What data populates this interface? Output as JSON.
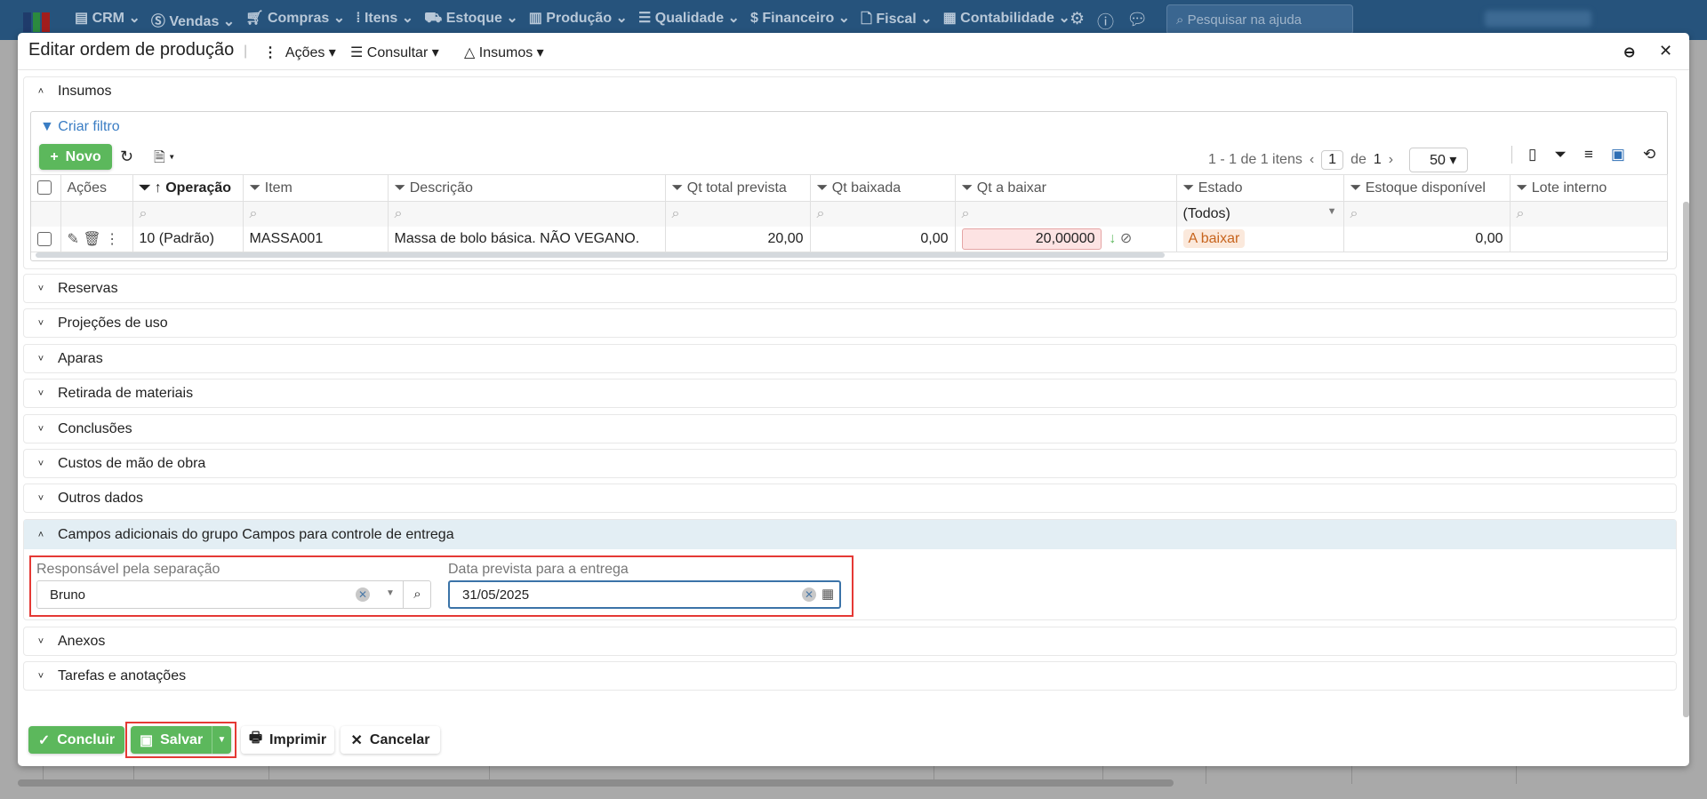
{
  "topnav": {
    "menus": [
      "CRM",
      "Vendas",
      "Compras",
      "Itens",
      "Estoque",
      "Produção",
      "Qualidade",
      "Financeiro",
      "Fiscal",
      "Contabilidade"
    ],
    "help_placeholder": "Pesquisar na ajuda"
  },
  "modal": {
    "title": "Editar ordem de produção",
    "toolbar": {
      "acoes": "Ações",
      "consultar": "Consultar",
      "insumos": "Insumos"
    }
  },
  "insumos": {
    "title": "Insumos",
    "criar_filtro": "Criar filtro",
    "novo": "Novo",
    "pagination": {
      "summary": "1 - 1 de 1 itens",
      "page": "1",
      "of": "de",
      "total": "1",
      "page_size": "50"
    },
    "columns": [
      "Ações",
      "Operação",
      "Item",
      "Descrição",
      "Qt total prevista",
      "Qt baixada",
      "Qt a baixar",
      "Estado",
      "Estoque disponível",
      "Lote interno"
    ],
    "estado_filter": "(Todos)",
    "rows": [
      {
        "operacao": "10 (Padrão)",
        "item": "MASSA001",
        "descricao": "Massa de bolo básica. NÃO VEGANO.",
        "qt_total_prevista": "20,00",
        "qt_baixada": "0,00",
        "qt_a_baixar": "20,00000",
        "estado": "A baixar",
        "estoque_disponivel": "0,00",
        "lote_interno": ""
      }
    ]
  },
  "sections": [
    "Reservas",
    "Projeções de uso",
    "Aparas",
    "Retirada de materiais",
    "Conclusões",
    "Custos de mão de obra",
    "Outros dados"
  ],
  "campos": {
    "title": "Campos adicionais do grupo Campos para controle de entrega",
    "responsavel_label": "Responsável pela separação",
    "responsavel_value": "Bruno",
    "data_label": "Data prevista para a entrega",
    "data_value": "31/05/2025"
  },
  "sections_after": [
    "Anexos",
    "Tarefas e anotações"
  ],
  "footer": {
    "concluir": "Concluir",
    "salvar": "Salvar",
    "imprimir": "Imprimir",
    "cancelar": "Cancelar"
  },
  "colors": {
    "topbar": "#26537c",
    "green": "#5cb85c",
    "highlight": "#e53935"
  }
}
